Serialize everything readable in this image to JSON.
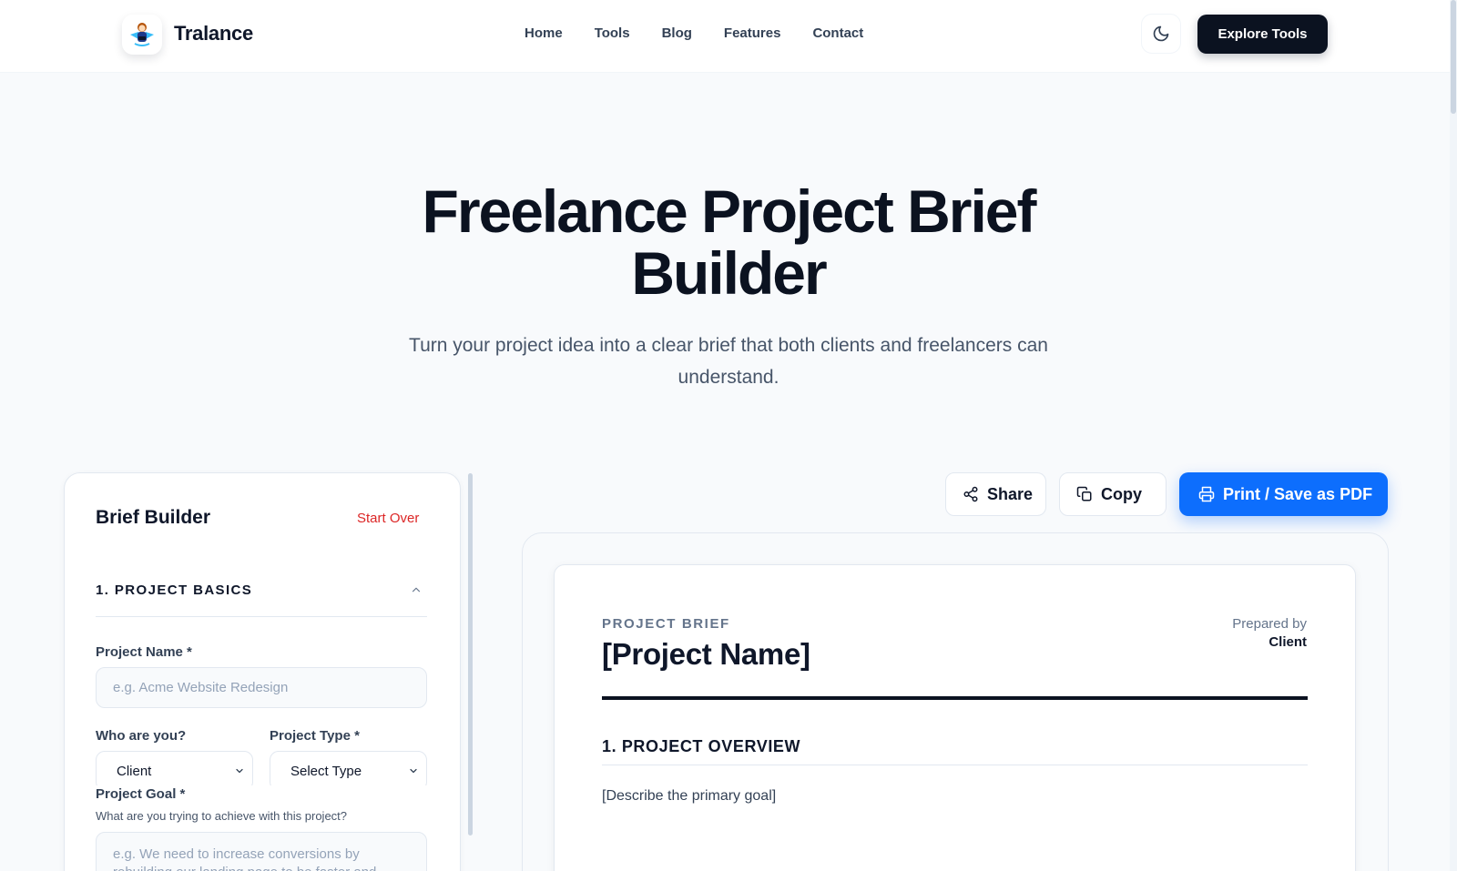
{
  "header": {
    "brand": "Tralance",
    "nav": [
      "Home",
      "Tools",
      "Blog",
      "Features",
      "Contact"
    ],
    "explore_label": "Explore Tools"
  },
  "hero": {
    "title_line1": "Freelance Project Brief",
    "title_line2": "Builder",
    "subtitle_line1": "Turn your project idea into a clear brief that both clients and freelancers can",
    "subtitle_line2": "understand."
  },
  "builder": {
    "title": "Brief Builder",
    "start_over": "Start Over",
    "section": "1. PROJECT BASICS",
    "project_name_label": "Project Name *",
    "project_name_placeholder": "e.g. Acme Website Redesign",
    "who_label": "Who are you?",
    "who_value": "Client",
    "type_label": "Project Type *",
    "type_value": "Select Type",
    "goal_label": "Project Goal *",
    "goal_hint": "What are you trying to achieve with this project?",
    "goal_placeholder": "e.g. We need to increase conversions by rebuilding our landing page to be faster and"
  },
  "actions": {
    "share": "Share",
    "copy": "Copy",
    "print": "Print / Save as PDF"
  },
  "preview": {
    "eyebrow": "PROJECT BRIEF",
    "title": "[Project Name]",
    "prepared_label": "Prepared by",
    "prepared_value": "Client",
    "section1": "1. PROJECT OVERVIEW",
    "section1_body": "[Describe the primary goal]"
  },
  "colors": {
    "primary": "#0d6efd",
    "dark": "#0b1220",
    "danger": "#dc2626"
  }
}
